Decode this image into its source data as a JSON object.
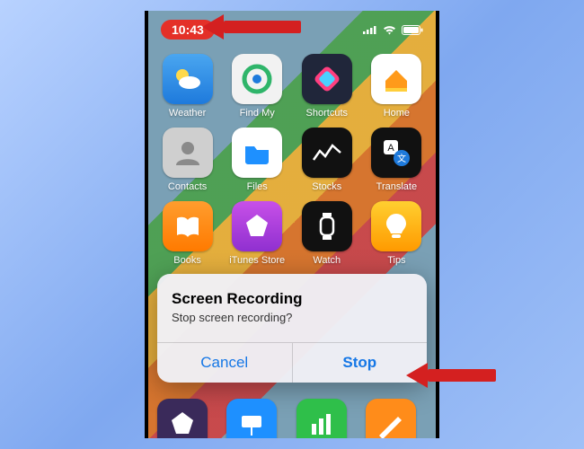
{
  "statusbar": {
    "time": "10:43"
  },
  "apps": [
    {
      "label": "Weather",
      "cls": "weather",
      "icon": "weather-icon"
    },
    {
      "label": "Find My",
      "cls": "findmy",
      "icon": "findmy-icon"
    },
    {
      "label": "Shortcuts",
      "cls": "shortcuts",
      "icon": "shortcuts-icon"
    },
    {
      "label": "Home",
      "cls": "home",
      "icon": "home-icon"
    },
    {
      "label": "Contacts",
      "cls": "contacts",
      "icon": "contacts-icon"
    },
    {
      "label": "Files",
      "cls": "files",
      "icon": "files-icon"
    },
    {
      "label": "Stocks",
      "cls": "stocks",
      "icon": "stocks-icon"
    },
    {
      "label": "Translate",
      "cls": "translate",
      "icon": "translate-icon"
    },
    {
      "label": "Books",
      "cls": "books",
      "icon": "books-icon"
    },
    {
      "label": "iTunes Store",
      "cls": "itunes",
      "icon": "itunes-icon"
    },
    {
      "label": "Watch",
      "cls": "watch",
      "icon": "watch-icon"
    },
    {
      "label": "Tips",
      "cls": "tips",
      "icon": "tips-icon"
    }
  ],
  "dock": [
    {
      "cls": "imovie",
      "icon": "imovie-icon"
    },
    {
      "cls": "keynote",
      "icon": "keynote-icon"
    },
    {
      "cls": "numbers",
      "icon": "numbers-icon"
    },
    {
      "cls": "pages",
      "icon": "pages-icon"
    }
  ],
  "dialog": {
    "title": "Screen Recording",
    "message": "Stop screen recording?",
    "cancel_label": "Cancel",
    "confirm_label": "Stop"
  }
}
